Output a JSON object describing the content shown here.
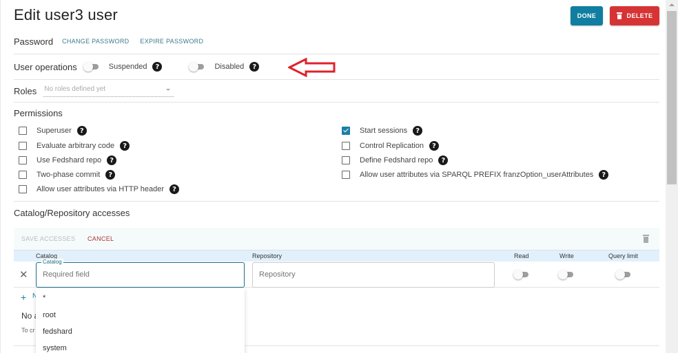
{
  "header": {
    "title": "Edit user3 user",
    "done_label": "DONE",
    "delete_label": "DELETE"
  },
  "password": {
    "label": "Password",
    "change_label": "CHANGE PASSWORD",
    "expire_label": "EXPIRE PASSWORD"
  },
  "user_operations": {
    "label": "User operations",
    "suspended": {
      "label": "Suspended",
      "on": false
    },
    "disabled": {
      "label": "Disabled",
      "on": false
    },
    "help_glyph": "?"
  },
  "roles": {
    "label": "Roles",
    "placeholder": "No roles defined yet"
  },
  "permissions": {
    "title": "Permissions",
    "left": [
      {
        "label": "Superuser",
        "checked": false
      },
      {
        "label": "Evaluate arbitrary code",
        "checked": false
      },
      {
        "label": "Use Fedshard repo",
        "checked": false
      },
      {
        "label": "Two-phase commit",
        "checked": false
      },
      {
        "label": "Allow user attributes via HTTP header",
        "checked": false
      }
    ],
    "right": [
      {
        "label": "Start sessions",
        "checked": true
      },
      {
        "label": "Control Replication",
        "checked": false
      },
      {
        "label": "Define Fedshard repo",
        "checked": false
      },
      {
        "label": "Allow user attributes via SPARQL PREFIX franzOption_userAttributes",
        "checked": false
      }
    ]
  },
  "accesses": {
    "title": "Catalog/Repository accesses",
    "save_label": "SAVE ACCESSES",
    "cancel_label": "CANCEL",
    "columns": {
      "catalog": "Catalog",
      "repository": "Repository",
      "read": "Read",
      "write": "Write",
      "query_limit": "Query limit"
    },
    "row": {
      "remove_glyph": "✕",
      "catalog_field_label": "Catalog",
      "catalog_placeholder": "Required field",
      "repository_placeholder": "Repository",
      "read": false,
      "write": false,
      "query_limit": false
    },
    "new_row_glyph": "+",
    "new_row_partial": "N",
    "no_accesses_partial": "No a",
    "to_create_partial": "To cr"
  },
  "catalog_dropdown": {
    "options": [
      "*",
      "root",
      "fedshard",
      "system"
    ]
  },
  "colors": {
    "primary": "#0f7ea0",
    "danger": "#d63434",
    "annotation_arrow": "#e0202a"
  }
}
